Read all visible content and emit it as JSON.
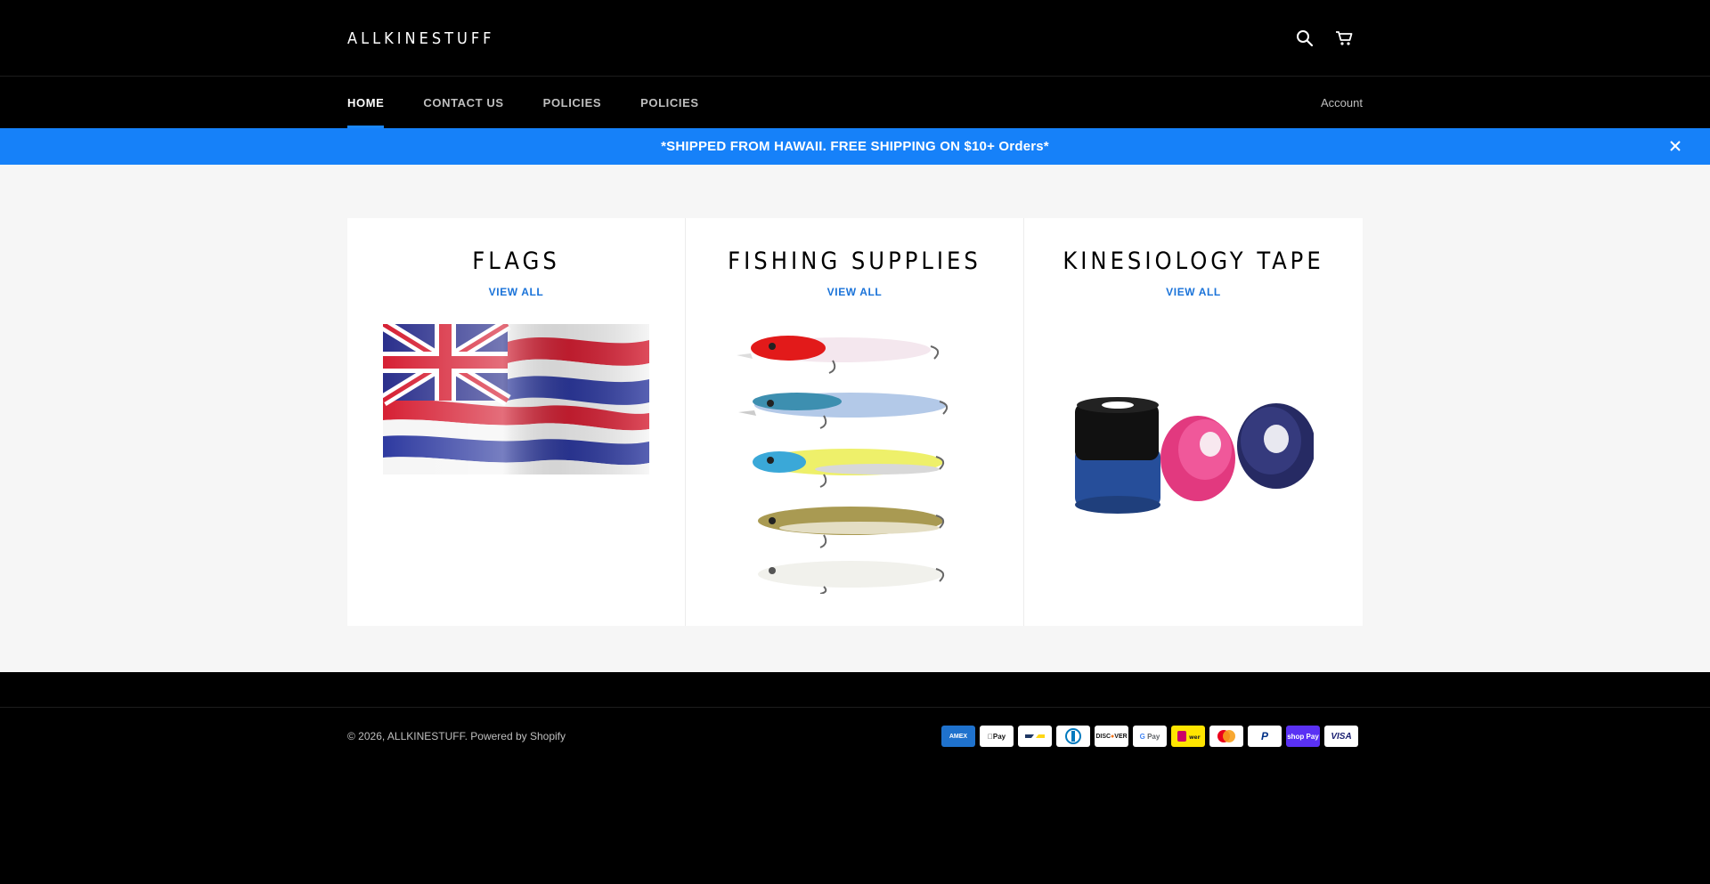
{
  "header": {
    "logo": "ALLKINESTUFF",
    "search_icon": "search-icon",
    "cart_icon": "cart-icon"
  },
  "nav": {
    "items": [
      {
        "label": "HOME",
        "active": true
      },
      {
        "label": "CONTACT US",
        "active": false
      },
      {
        "label": "POLICIES",
        "active": false
      },
      {
        "label": "POLICIES",
        "active": false
      }
    ],
    "account": "Account"
  },
  "announcement": {
    "text": "*SHIPPED FROM HAWAII. FREE SHIPPING ON $10+ Orders*",
    "background": "#1681f9"
  },
  "collections": [
    {
      "title": "FLAGS",
      "link": "VIEW ALL",
      "image": "hawaii-flag"
    },
    {
      "title": "FISHING SUPPLIES",
      "link": "VIEW ALL",
      "image": "fishing-lures"
    },
    {
      "title": "KINESIOLOGY TAPE",
      "link": "VIEW ALL",
      "image": "tape-rolls"
    }
  ],
  "footer": {
    "copyright_prefix": "© 2026,",
    "shop_name": "ALLKINESTUFF",
    "powered": ". Powered by Shopify",
    "payments": [
      "American Express",
      "Apple Pay",
      "Bancontact",
      "Diners Club",
      "Discover",
      "Google Pay",
      "iDEAL | Wero",
      "Mastercard",
      "PayPal",
      "Shop Pay",
      "Visa"
    ]
  },
  "colors": {
    "accent": "#1a87f8",
    "link": "#1a73d9",
    "page_bg": "#f6f6f6"
  }
}
